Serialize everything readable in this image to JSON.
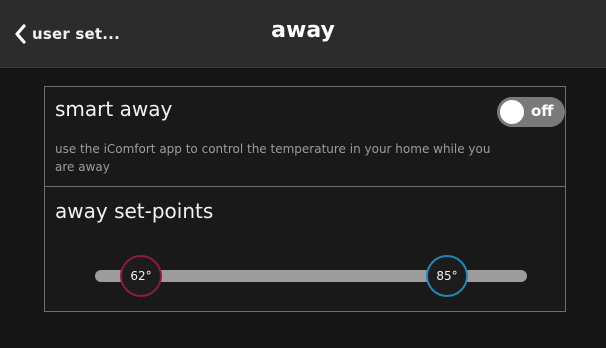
{
  "header": {
    "back_label": "user set...",
    "title": "away"
  },
  "smart_away": {
    "title": "smart away",
    "description": "use the iComfort app to control the temperature in your home while you are away",
    "toggle": {
      "state_label": "off",
      "on": false
    }
  },
  "setpoints": {
    "title": "away set-points",
    "heat_label": "62°",
    "cool_label": "85°",
    "heat_value": 62,
    "cool_value": 85,
    "colors": {
      "heat": "#8e1b3a",
      "cool": "#2386b8",
      "track": "#9c9c9c"
    }
  },
  "icons": {
    "back": "chevron-left-icon"
  }
}
